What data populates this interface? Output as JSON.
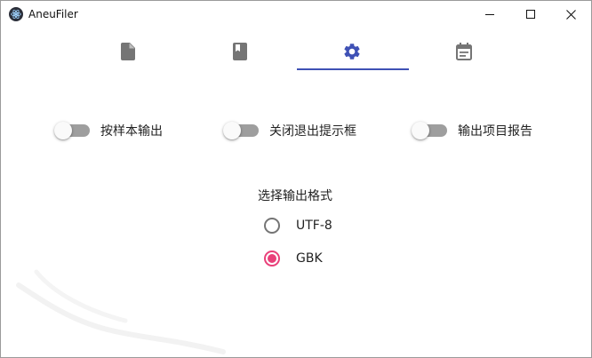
{
  "window": {
    "title": "AneuFiler",
    "controls": [
      "minimize",
      "maximize",
      "close"
    ]
  },
  "tabs": [
    {
      "icon": "document-icon",
      "active": false
    },
    {
      "icon": "book-icon",
      "active": false
    },
    {
      "icon": "gear-icon",
      "active": true
    },
    {
      "icon": "calendar-icon",
      "active": false
    }
  ],
  "toggles": [
    {
      "label": "按样本输出",
      "checked": false
    },
    {
      "label": "关闭退出提示框",
      "checked": false
    },
    {
      "label": "输出项目报告",
      "checked": false
    }
  ],
  "output_format": {
    "title": "选择输出格式",
    "options": [
      {
        "label": "UTF-8",
        "selected": false
      },
      {
        "label": "GBK",
        "selected": true
      }
    ]
  },
  "colors": {
    "accent": "#3f51b5",
    "radio_selected": "#e9407a",
    "icon_inactive": "#757575",
    "switch_track_off": "#9e9e9e"
  }
}
